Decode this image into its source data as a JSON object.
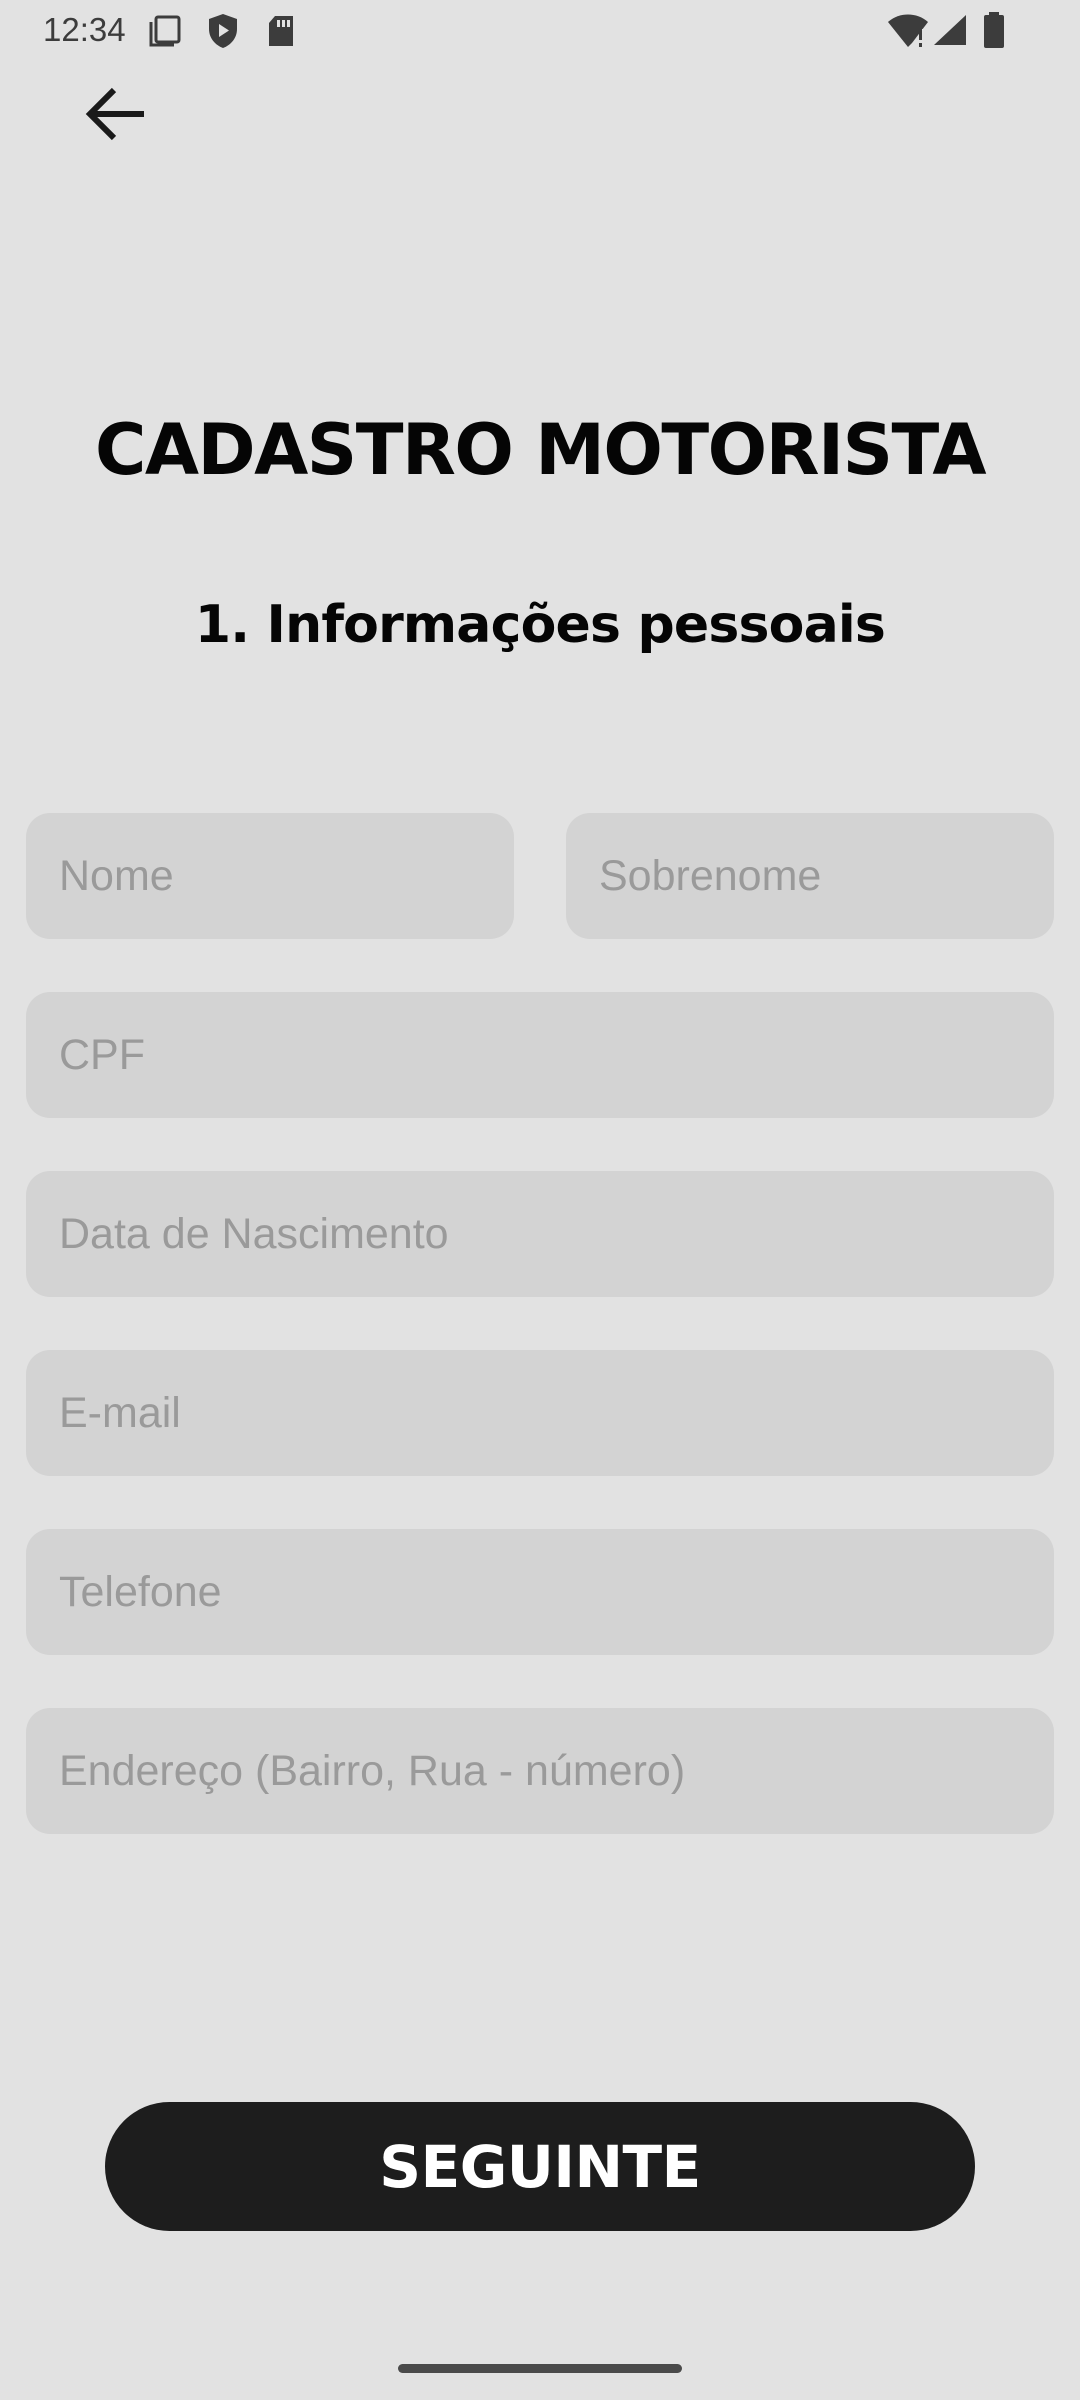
{
  "status_bar": {
    "time": "12:34",
    "icons_left": [
      "screenshot-icon",
      "shield-play-icon",
      "sd-card-icon"
    ],
    "icons_right": [
      "wifi-alert-icon",
      "cellular-signal-icon",
      "battery-icon"
    ]
  },
  "navigation": {
    "back_icon": "arrow-left-icon"
  },
  "header": {
    "title": "CADASTRO MOTORISTA",
    "section": "1. Informações pessoais"
  },
  "form": {
    "first_name": {
      "placeholder": "Nome",
      "value": ""
    },
    "last_name": {
      "placeholder": "Sobrenome",
      "value": ""
    },
    "cpf": {
      "placeholder": "CPF",
      "value": ""
    },
    "birth_date": {
      "placeholder": "Data de Nascimento",
      "value": ""
    },
    "email": {
      "placeholder": "E-mail",
      "value": ""
    },
    "phone": {
      "placeholder": "Telefone",
      "value": ""
    },
    "address": {
      "placeholder": "Endereço (Bairro, Rua - número)",
      "value": ""
    }
  },
  "actions": {
    "next_label": "SEGUINTE"
  },
  "colors": {
    "background": "#e2e2e2",
    "field_background": "#d3d3d3",
    "placeholder": "#9a9a9a",
    "button_background": "#1d1d1d",
    "button_text": "#ffffff"
  }
}
